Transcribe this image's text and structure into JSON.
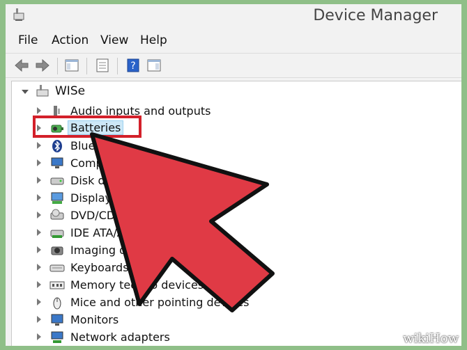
{
  "window": {
    "title": "Device Manager"
  },
  "menu": [
    "File",
    "Action",
    "View",
    "Help"
  ],
  "toolbar": {
    "icons": [
      "back-icon",
      "forward-icon",
      "console-tree-icon",
      "properties-icon",
      "help-icon",
      "action-pane-icon"
    ]
  },
  "tree": {
    "root": "WISe",
    "items": [
      {
        "label": "Audio inputs and outputs",
        "icon": "speaker-icon"
      },
      {
        "label": "Batteries",
        "icon": "battery-icon",
        "selected": true
      },
      {
        "label": "Blue",
        "icon": "bluetooth-icon"
      },
      {
        "label": "Comp",
        "icon": "computer-icon"
      },
      {
        "label": "Disk dr",
        "icon": "disk-drive-icon"
      },
      {
        "label": "Display a",
        "icon": "display-adapter-icon"
      },
      {
        "label": "DVD/CD-R",
        "icon": "dvd-drive-icon"
      },
      {
        "label": "IDE ATA/AT",
        "icon": "ide-controller-icon"
      },
      {
        "label": "Imaging devic",
        "icon": "camera-icon"
      },
      {
        "label": "Keyboards",
        "icon": "keyboard-icon"
      },
      {
        "label": "Memory techno        devices",
        "icon": "memory-icon"
      },
      {
        "label": "Mice and other pointing devices",
        "icon": "mouse-icon"
      },
      {
        "label": "Monitors",
        "icon": "monitor-icon"
      },
      {
        "label": "Network adapters",
        "icon": "network-adapter-icon"
      }
    ]
  },
  "watermark": "wikiHow",
  "colors": {
    "highlight": "#d3202a",
    "arrow": "#e03a45",
    "frame": "#8fbf88"
  }
}
